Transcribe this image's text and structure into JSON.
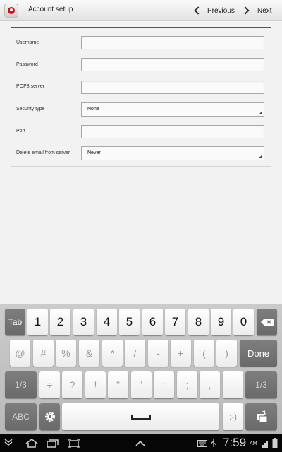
{
  "action_bar": {
    "title": "Account setup",
    "previous_label": "Previous",
    "next_label": "Next"
  },
  "form": {
    "username_label": "Username",
    "password_label": "Password",
    "pop3_label": "POP3 server",
    "security_label": "Security type",
    "security_value": "None",
    "port_label": "Port",
    "delete_label": "Delete email from server",
    "delete_value": "Never"
  },
  "keyboard": {
    "row1": [
      "Tab",
      "1",
      "2",
      "3",
      "4",
      "5",
      "6",
      "7",
      "8",
      "9",
      "0"
    ],
    "row2": [
      "@",
      "#",
      "%",
      "&",
      "*",
      "/",
      "-",
      "+",
      "(",
      ")"
    ],
    "done_label": "Done",
    "row3_left": "1/3",
    "row3": [
      "÷",
      "?",
      "!",
      "\"",
      "'",
      ":",
      ";",
      ",",
      "."
    ],
    "row3_right": "1/3",
    "abc_label": "ABC",
    "smiley_label": ":-)"
  },
  "status_bar": {
    "time": "7:59",
    "ampm": "AM"
  },
  "icons": [
    "app-email-icon",
    "chevron-left-icon",
    "chevron-right-icon",
    "backspace-icon",
    "settings-gear-icon",
    "space-bar-icon",
    "clipboard-icon",
    "back-icon",
    "home-icon",
    "recent-apps-icon",
    "screenshot-icon",
    "keyboard-icon",
    "usb-icon",
    "signal-icon",
    "battery-icon"
  ]
}
